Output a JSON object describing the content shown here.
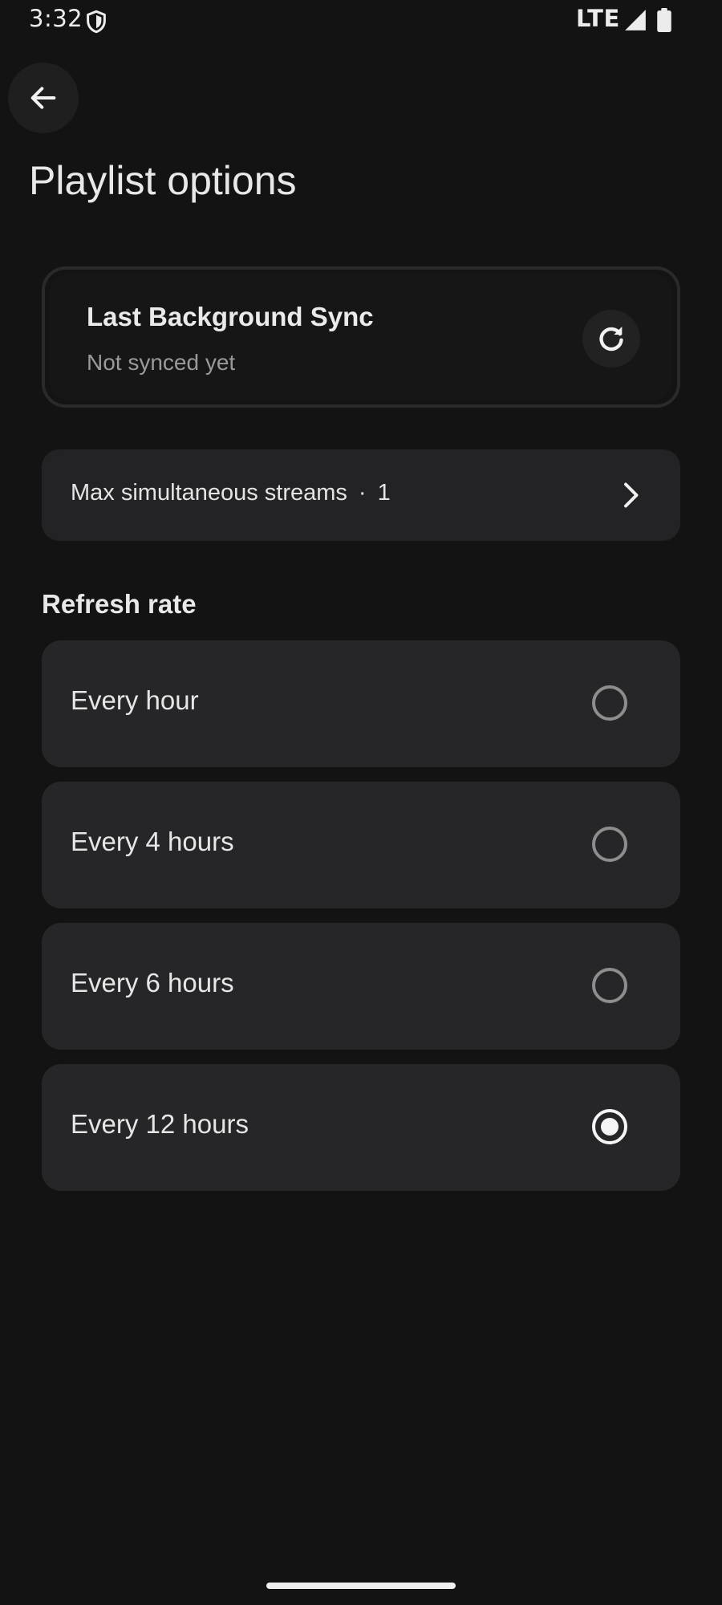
{
  "status_bar": {
    "time": "3:32",
    "network": "LTE",
    "icons": [
      "shield-icon",
      "signal-icon",
      "battery-icon"
    ]
  },
  "header": {
    "back_icon": "arrow-left-icon",
    "title": "Playlist options"
  },
  "sync_card": {
    "title": "Last Background Sync",
    "subtitle": "Not synced yet",
    "action_icon": "refresh-icon"
  },
  "streams": {
    "label": "Max simultaneous streams",
    "separator": "·",
    "value": "1",
    "icon": "chevron-right-icon"
  },
  "refresh_rate": {
    "title": "Refresh rate",
    "options": [
      {
        "label": "Every hour",
        "selected": false
      },
      {
        "label": "Every 4 hours",
        "selected": false
      },
      {
        "label": "Every 6 hours",
        "selected": false
      },
      {
        "label": "Every 12 hours",
        "selected": true
      }
    ]
  },
  "colors": {
    "background": "#131313",
    "card": "#262628",
    "text": "#e6e6e6",
    "muted": "#9a9a9a"
  }
}
